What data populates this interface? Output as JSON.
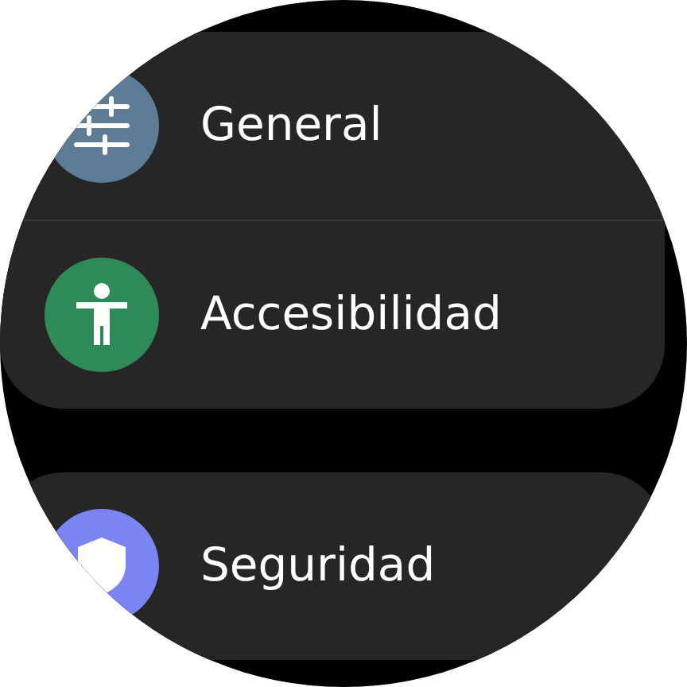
{
  "groups": [
    {
      "items": [
        {
          "label": "General",
          "kind": "sliders",
          "color": "#5e7c96"
        },
        {
          "label": "Accesibilidad",
          "kind": "accessibility",
          "color": "#2e8a57"
        }
      ]
    },
    {
      "items": [
        {
          "label": "Seguridad",
          "kind": "shield",
          "color": "#7a84f2"
        }
      ]
    }
  ]
}
